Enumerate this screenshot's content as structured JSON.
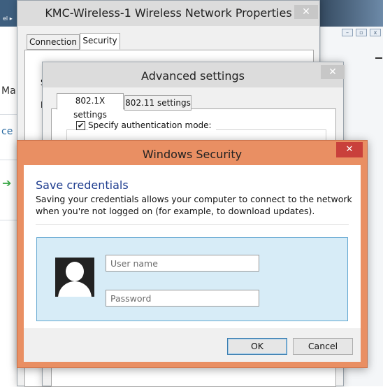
{
  "background_app": {
    "menu_fragment": "el ▸",
    "side_text_1": "Ma",
    "side_text_2": "ce",
    "arrow_icon": "green-arrow"
  },
  "network_properties": {
    "title": "KMC-Wireless-1 Wireless Network Properties",
    "close_glyph": "✕",
    "tabs": [
      "Connection",
      "Security"
    ],
    "active_tab": "Security",
    "frag_1": "S",
    "frag_2": "E"
  },
  "advanced_settings": {
    "title": "Advanced settings",
    "close_glyph": "✕",
    "tabs": [
      "802.1X settings",
      "802.11 settings"
    ],
    "active_tab": "802.1X settings",
    "checkbox_label": "Specify authentication mode:",
    "checkbox_checked": true
  },
  "windows_security": {
    "title": "Windows Security",
    "close_glyph": "✕",
    "heading": "Save credentials",
    "description_line1": "Saving your credentials allows your computer to connect to the network",
    "description_line2": "when you're not logged on (for example, to download updates).",
    "username_placeholder": "User name",
    "password_placeholder": "Password",
    "ok_label": "OK",
    "cancel_label": "Cancel",
    "accent_color": "#e98f63",
    "close_color": "#c9403b"
  }
}
